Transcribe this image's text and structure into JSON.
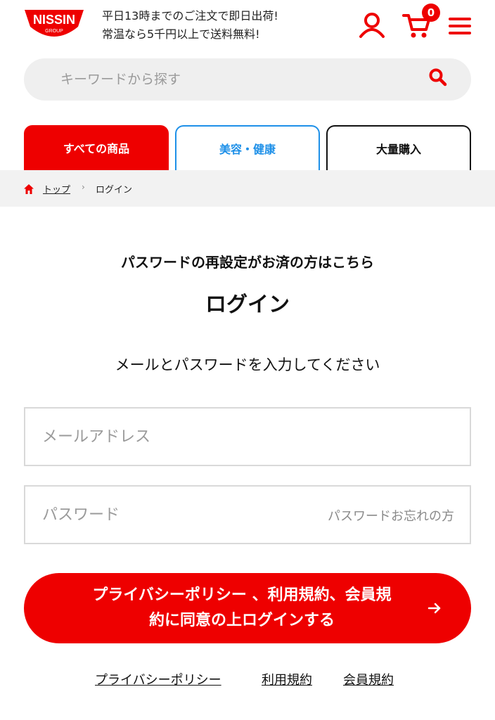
{
  "header": {
    "logo_text": "NISSIN",
    "logo_subtext": "GROUP",
    "promo_line1": "平日13時までのご注文で即日出荷!",
    "promo_line2": "常温なら5千円以上で送料無料!",
    "cart_count": "0",
    "icons": [
      "user-icon",
      "cart-icon",
      "menu-icon"
    ],
    "brand_color": "#ee0000"
  },
  "search": {
    "placeholder": "キーワードから探す",
    "icon": "search-icon"
  },
  "tabs": [
    {
      "label": "すべての商品",
      "color": "#ee0000",
      "active": true
    },
    {
      "label": "美容・健康",
      "color": "#1e90e8",
      "active": false
    },
    {
      "label": "大量購入",
      "color": "#111111",
      "active": false
    }
  ],
  "breadcrumb": {
    "home_icon": "home-icon",
    "top": "トップ",
    "separator": "›",
    "current": "ログイン"
  },
  "main": {
    "reset_link": "パスワードの再設定がお済の方はこちら",
    "title": "ログイン",
    "instruction": "メールとパスワードを入力してください",
    "email_placeholder": "メールアドレス",
    "password_placeholder": "パスワード",
    "forgot_password": "パスワードお忘れの方",
    "login_button_line1": "プライバシーポリシー 、利用規約、会員規",
    "login_button_line2": "約に同意の上ログインする"
  },
  "footer_links": {
    "privacy": "プライバシーポリシー",
    "terms": "利用規約",
    "membership": "会員規約"
  }
}
